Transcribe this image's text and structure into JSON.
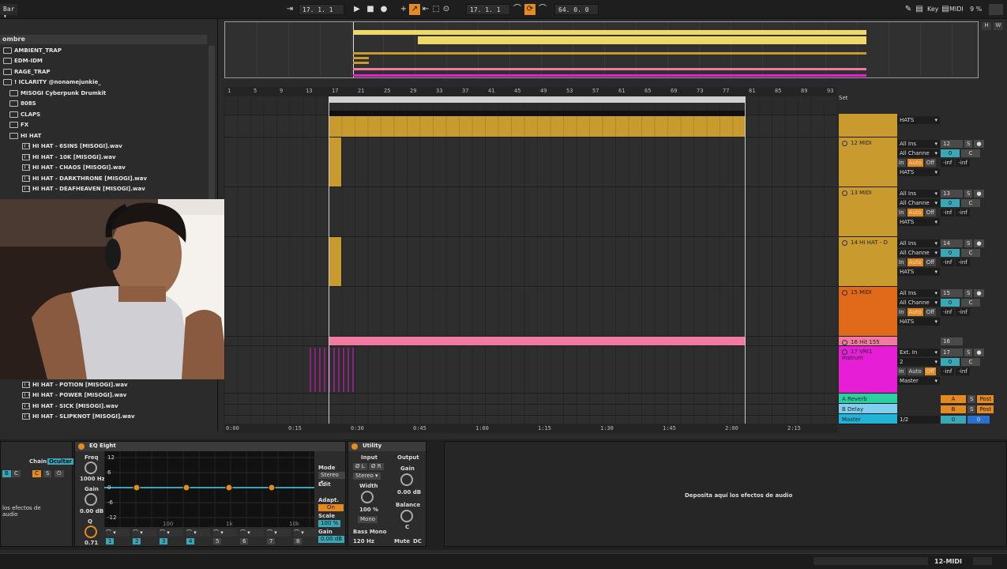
{
  "topbar": {
    "left_label": "Bar",
    "arrangement_position": "17.  1.  1",
    "punch_position": "17.  1.  1",
    "loop_length": "64.  0.  0",
    "key_label": "Key",
    "midi_label": "MIDI",
    "cpu": "9 %"
  },
  "browser": {
    "header": "ombre",
    "items": [
      {
        "label": "AMBIENT_TRAP",
        "type": "folder"
      },
      {
        "label": "EDM-IDM",
        "type": "folder"
      },
      {
        "label": "RAGE_TRAP",
        "type": "folder"
      },
      {
        "label": "! ICLARITY @nonamejunkie_",
        "type": "folder"
      },
      {
        "label": "MISOGI Cyberpunk Drumkit",
        "type": "folder"
      },
      {
        "label": "808S",
        "type": "folder"
      },
      {
        "label": "CLAPS",
        "type": "folder"
      },
      {
        "label": "FX",
        "type": "folder"
      },
      {
        "label": "HI HAT",
        "type": "folder"
      },
      {
        "label": "HI HAT - 6SINS [MISOGI].wav",
        "type": "wav"
      },
      {
        "label": "HI HAT - 10K [MISOGI].wav",
        "type": "wav"
      },
      {
        "label": "HI HAT - CHAOS [MISOGI].wav",
        "type": "wav"
      },
      {
        "label": "HI HAT - DARKTHRONE [MISOGI].wav",
        "type": "wav"
      },
      {
        "label": "HI HAT - DEAFHEAVEN [MISOGI].wav",
        "type": "wav"
      }
    ],
    "items_bottom": [
      {
        "label": "HI HAT - POTION [MISOGI].wav",
        "type": "wav"
      },
      {
        "label": "HI HAT - POWER [MISOGI].wav",
        "type": "wav"
      },
      {
        "label": "HI HAT - SICK [MISOGI].wav",
        "type": "wav"
      },
      {
        "label": "HI HAT - SLIPKNOT [MISOGI].wav",
        "type": "wav"
      }
    ]
  },
  "ruler_marks": [
    "1",
    "5",
    "9",
    "13",
    "17",
    "21",
    "25",
    "29",
    "33",
    "37",
    "41",
    "45",
    "49",
    "53",
    "57",
    "61",
    "65",
    "69",
    "73",
    "77",
    "81",
    "85",
    "89",
    "93"
  ],
  "time_marks": [
    "0:00",
    "0:15",
    "0:30",
    "0:45",
    "1:00",
    "1:15",
    "1:30",
    "1:45",
    "2:00",
    "2:15"
  ],
  "set_label": "Set",
  "tracks": [
    {
      "name": "",
      "input": "HATS",
      "vol": "",
      "pan": "",
      "color": "#c99a2e"
    },
    {
      "name": "12 MIDI",
      "num": "12",
      "input_type": "All Ins",
      "channel": "All Channe",
      "monitor_in": "In",
      "monitor_auto": "Auto",
      "monitor_off": "Off",
      "input": "HATS",
      "vol": "0",
      "pan": "C",
      "peak1": "-inf",
      "peak2": "-inf",
      "color": "#c99a2e"
    },
    {
      "name": "13 MIDI",
      "num": "13",
      "input_type": "All Ins",
      "channel": "All Channe",
      "monitor_in": "In",
      "monitor_auto": "Auto",
      "monitor_off": "Off",
      "input": "HATS",
      "vol": "0",
      "pan": "C",
      "peak1": "-inf",
      "peak2": "-inf",
      "color": "#c99a2e"
    },
    {
      "name": "14 HI HAT - D",
      "num": "14",
      "input_type": "All Ins",
      "channel": "All Channe",
      "monitor_in": "In",
      "monitor_auto": "Auto",
      "monitor_off": "Off",
      "input": "HATS",
      "vol": "0",
      "pan": "C",
      "peak1": "-inf",
      "peak2": "-inf",
      "color": "#c99a2e"
    },
    {
      "name": "15 MIDI",
      "num": "15",
      "input_type": "All Ins",
      "channel": "All Channe",
      "monitor_in": "In",
      "monitor_auto": "Auto",
      "monitor_off": "Off",
      "input": "HATS",
      "vol": "0",
      "pan": "C",
      "peak1": "-inf",
      "peak2": "-inf",
      "color": "#e0691a"
    },
    {
      "name": "16 Hit 155",
      "num": "16",
      "color": "#f27aa0"
    },
    {
      "name": "17 VRI1 Instrum",
      "num": "17",
      "input_type": "Ext. In",
      "channel": "2",
      "monitor_in": "In",
      "monitor_auto": "Auto",
      "monitor_off": "Off",
      "input": "Master",
      "vol": "0",
      "pan": "C",
      "peak1": "-inf",
      "peak2": "-inf",
      "color": "#e61fd7"
    }
  ],
  "returns": [
    {
      "name": "A Reverb",
      "letter": "A",
      "mode": "Post",
      "color": "#2bd0a0"
    },
    {
      "name": "B Delay",
      "letter": "B",
      "mode": "Post",
      "color": "#7fd0f0"
    }
  ],
  "master": {
    "name": "Master",
    "out": "1/2",
    "vol": "0",
    "pan": "0",
    "color": "#22b4d8"
  },
  "devices": {
    "chain_label": "Chain",
    "chain_state": "Ocultar",
    "drop_hint_left": "los efectos de\naudio",
    "eq": {
      "title": "EQ Eight",
      "freq_label": "Freq",
      "freq_value": "1000 Hz",
      "gain_label": "Gain",
      "gain_value": "0.00 dB",
      "q_label": "Q",
      "q_value": "0.71",
      "db_ticks": [
        "12",
        "6",
        "0",
        "-6",
        "-12"
      ],
      "freq_ticks": [
        "100",
        "1k",
        "10k"
      ],
      "mode_label": "Mode",
      "mode_value": "Stereo",
      "edit_label": "Edit",
      "adapt_label": "Adapt. Q",
      "adapt_value": "On",
      "scale_label": "Scale",
      "scale_value": "100 %",
      "gain2_label": "Gain",
      "gain2_value": "0.00 dB",
      "bands": [
        "1",
        "2",
        "3",
        "4",
        "5",
        "6",
        "7",
        "8"
      ]
    },
    "utility": {
      "title": "Utility",
      "input_label": "Input",
      "output_label": "Output",
      "phase_l": "Ø L",
      "phase_r": "Ø R",
      "stereo_label": "Stereo",
      "width_label": "Width",
      "width_value": "100 %",
      "mono_label": "Mono",
      "bass_mono_label": "Bass Mono",
      "bass_freq": "120 Hz",
      "gain_label": "Gain",
      "gain_value": "0.00 dB",
      "balance_label": "Balance",
      "balance_value": "C",
      "mute_label": "Mute",
      "dc_label": "DC"
    },
    "drop_hint": "Deposita aquí los efectos de audio"
  },
  "status": {
    "selected_track": "12-MIDI"
  }
}
